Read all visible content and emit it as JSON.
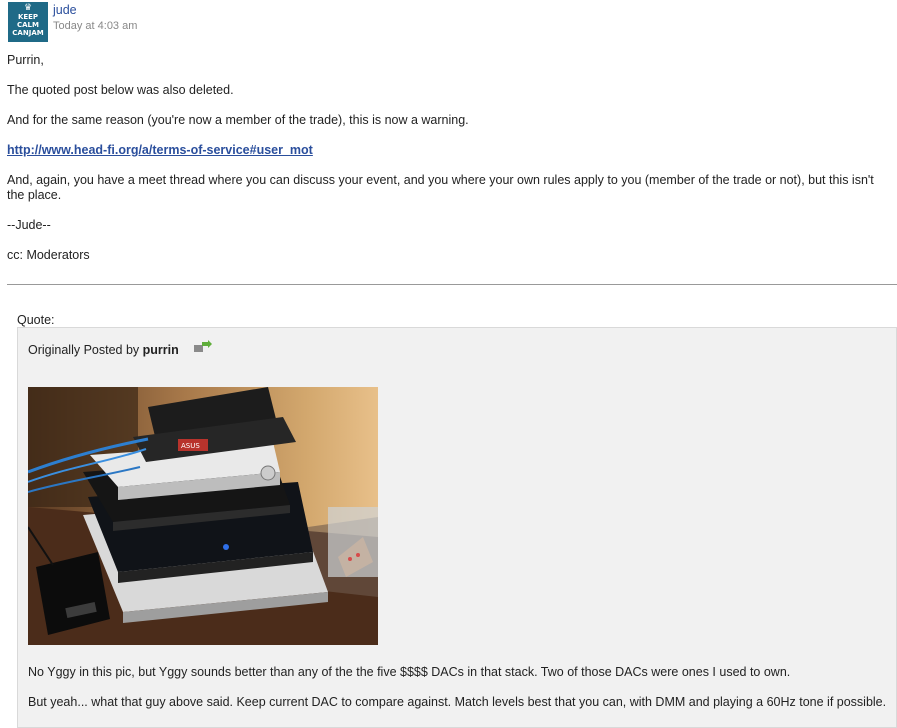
{
  "post": {
    "avatar": {
      "crown_glyph": "♛",
      "line1": "KEEP",
      "line2": "CALM",
      "line3": "CANJAM"
    },
    "author": "jude",
    "timestamp": "Today at 4:03 am",
    "paragraphs": {
      "greeting": "Purrin,",
      "p1": "The quoted post below was also deleted.",
      "p2": "And for the same reason (you're now a member of the trade), this is now a warning.",
      "link": "http://www.head-fi.org/a/terms-of-service#user_mot",
      "p3": "And, again, you have a meet thread where you can discuss your event, and you where your own rules apply to you (member of the trade or not), but this isn't the place.",
      "signature": "--Jude--",
      "cc": "cc: Moderators"
    }
  },
  "quote": {
    "label": "Quote:",
    "originally_posted_by": "Originally Posted by",
    "author": "purrin",
    "share_icon": "share-arrow-icon",
    "photo_label": "ASUS",
    "text1": "No Yggy in this pic, but Yggy sounds better than any of the the five $$$$ DACs in that stack. Two of those DACs were ones I used to own.",
    "text2": "But yeah... what that guy above said. Keep current DAC to compare against. Match levels best that you can, with DMM and playing a 60Hz tone if possible."
  },
  "colors": {
    "link": "#2a4e9c",
    "quote_bg": "#f1f1f1",
    "avatar_bg": "#1f6a87"
  }
}
